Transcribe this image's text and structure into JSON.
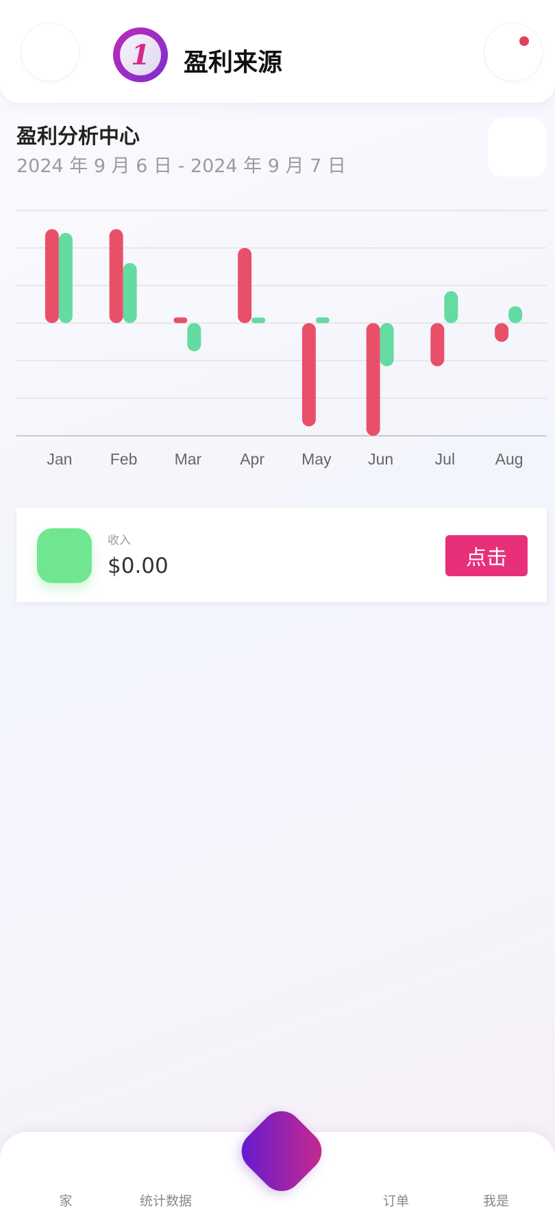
{
  "header": {
    "logo_text": "1",
    "title": "盈利来源"
  },
  "analysis": {
    "title": "盈利分析中心",
    "date_range": "2024 年 9 月 6 日 - 2024 年 9 月 7 日"
  },
  "chart_data": {
    "type": "bar",
    "categories": [
      "Jan",
      "Feb",
      "Mar",
      "Apr",
      "May",
      "Jun",
      "Jul",
      "Aug"
    ],
    "series": [
      {
        "values": [
          5,
          5,
          0.3,
          4,
          -5.5,
          -6,
          -2.3,
          -1
        ]
      },
      {
        "values": [
          4.8,
          3.2,
          -1.5,
          0.1,
          0.3,
          -2.3,
          1.7,
          0.9
        ]
      }
    ],
    "ylim": [
      -6,
      6
    ],
    "grid": true,
    "colors": [
      "#e8506a",
      "#64dba0"
    ]
  },
  "income_card": {
    "label": "收入",
    "value": "$0.00",
    "button_label": "点击",
    "icon_color": "#70e690"
  },
  "nav": {
    "home": "家",
    "stats": "统计数据",
    "orders": "订单",
    "me": "我是"
  }
}
